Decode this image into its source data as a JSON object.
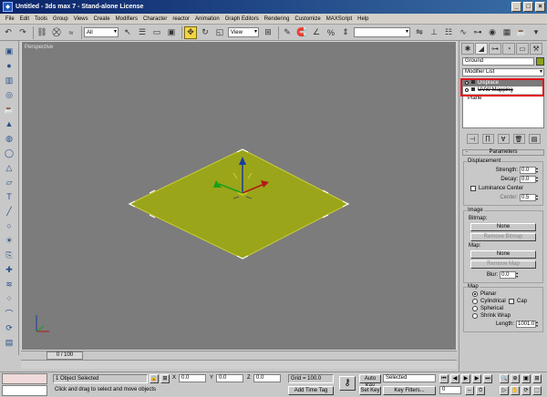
{
  "window": {
    "title": "Untitled - 3ds max 7   -   Stand-alone License",
    "minimize": "_",
    "maximize": "□",
    "close": "×"
  },
  "menu": [
    "File",
    "Edit",
    "Tools",
    "Group",
    "Views",
    "Create",
    "Modifiers",
    "Character",
    "reactor",
    "Animation",
    "Graph Editors",
    "Rendering",
    "Customize",
    "MAXScript",
    "Help"
  ],
  "toolbar": {
    "selection_filter": "All",
    "reference_coord": "View"
  },
  "viewport": {
    "label": "Perspective"
  },
  "timeslider": {
    "frame": "0 / 100"
  },
  "command_panel": {
    "object_name": "Ground",
    "object_color": "#8aa21a",
    "modifier_list": "Modifier List",
    "stack": {
      "selected": "Displace",
      "second": "UVW Mapping",
      "base": "Plane"
    },
    "params": {
      "rollout_title": "Parameters",
      "displacement_group": "Displacement",
      "strength_label": "Strength:",
      "strength_value": "0.0",
      "decay_label": "Decay:",
      "decay_value": "0.0",
      "luminance_label": "Luminance Center",
      "center_label": "Center:",
      "center_value": "0.5",
      "image_group": "Image",
      "bitmap_label": "Bitmap:",
      "bitmap_btn": "None",
      "remove_bitmap": "Remove Bitmap",
      "map_label": "Map:",
      "map_btn": "None",
      "remove_map": "Remove Map",
      "blur_label": "Blur:",
      "blur_value": "0.0",
      "map_group": "Map",
      "planar": "Planar",
      "cylindrical": "Cylindrical",
      "cap": "Cap",
      "spherical": "Spherical",
      "shrink_wrap": "Shrink Wrap",
      "length_label": "Length:",
      "length_value": "1001.0"
    }
  },
  "status": {
    "selected_count": "1 Object Selected",
    "prompt": "Click and drag to select and move objects",
    "x_label": "X",
    "x_value": "0.0",
    "y_label": "Y",
    "y_value": "0.0",
    "z_label": "Z",
    "z_value": "0.0",
    "grid": "Grid = 100.0",
    "add_time_tag": "Add Time Tag",
    "auto_key": "Auto Key",
    "auto_key_value": "Selected",
    "set_key": "Set Key",
    "key_filters": "Key Filters...",
    "frame_value": "0"
  }
}
